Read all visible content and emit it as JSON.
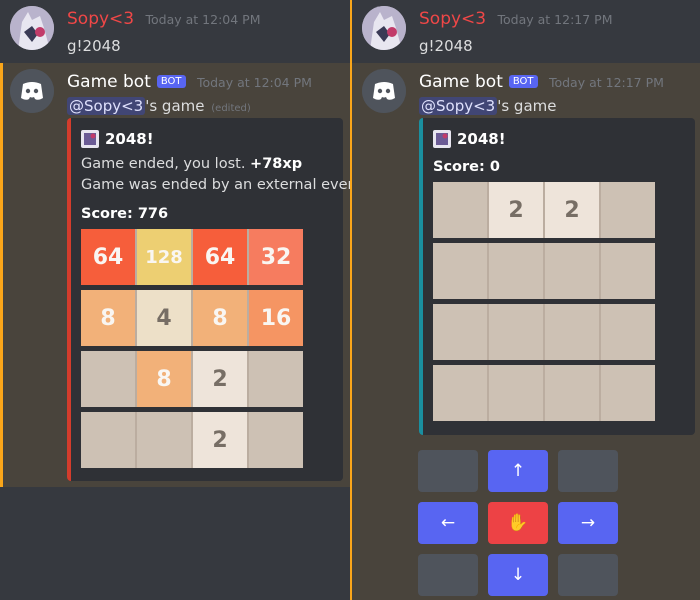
{
  "left": {
    "user_msg": {
      "username": "Sopy<3",
      "timestamp": "Today at 12:04 PM",
      "text": "g!2048"
    },
    "bot_msg": {
      "botname": "Game bot",
      "bot_tag": "BOT",
      "timestamp": "Today at 12:04 PM",
      "mention": "@Sopy<3",
      "mention_suffix": "'s game",
      "edited": "(edited)",
      "embed": {
        "title": "2048!",
        "line1_prefix": "Game ended, you lost. ",
        "line1_xp": "+78xp",
        "line2": "Game was ended by an external event",
        "score": "Score: 776",
        "board": [
          [
            "64",
            "128",
            "64",
            "32"
          ],
          [
            "8",
            "4",
            "8",
            "16"
          ],
          [
            "",
            "8",
            "2",
            ""
          ],
          [
            "",
            "",
            "2",
            ""
          ]
        ]
      }
    }
  },
  "right": {
    "user_msg": {
      "username": "Sopy<3",
      "timestamp": "Today at 12:17 PM",
      "text": "g!2048"
    },
    "bot_msg": {
      "botname": "Game bot",
      "bot_tag": "BOT",
      "timestamp": "Today at 12:17 PM",
      "mention": "@Sopy<3",
      "mention_suffix": "'s game",
      "embed": {
        "title": "2048!",
        "score": "Score: 0",
        "board": [
          [
            "",
            "2",
            "2",
            ""
          ],
          [
            "",
            "",
            "",
            ""
          ],
          [
            "",
            "",
            "",
            ""
          ],
          [
            "",
            "",
            "",
            ""
          ]
        ]
      }
    },
    "controls": {
      "up": "↑",
      "left": "←",
      "stop": "✋",
      "right": "→",
      "down": "↓"
    }
  },
  "colors": {
    "tile_2": "#eee4da",
    "tile_4": "#ede0c8",
    "tile_8": "#f2b179",
    "tile_16": "#f59563",
    "tile_32": "#f67c5f",
    "tile_64": "#f65e3b",
    "tile_128": "#edcf72",
    "tile_empty": "#cdc1b4",
    "accent_red": "#d33c2c",
    "accent_teal": "#1a8fa0",
    "blurple": "#5865f2"
  }
}
